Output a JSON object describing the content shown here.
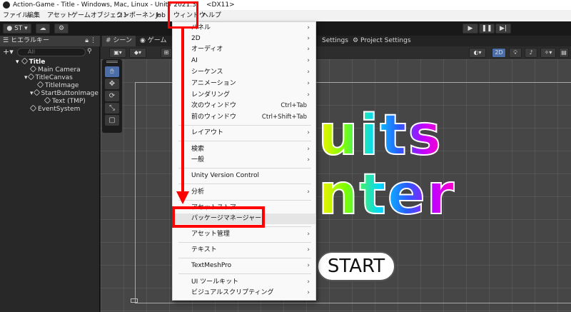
{
  "window": {
    "title_left": "Action-Game - Title - Windows, Mac, Linux - Unity 2021.3",
    "title_right": "<DX11>"
  },
  "menubar": [
    "ファイル",
    "編集",
    "アセット",
    "ゲームオブジェクト",
    "コンポーネント",
    "Job",
    "ウィンドウ",
    "ヘルプ"
  ],
  "toolbar": {
    "account": "ST",
    "play": "▶",
    "pause": "❚❚",
    "step": "▶|"
  },
  "hierarchy": {
    "tab_label": "ヒエラルキー",
    "search_placeholder": "All",
    "scene": "Title",
    "items": [
      "Main Camera",
      "TitleCanvas",
      "TitleImage",
      "StartButtonImage",
      "Text (TMP)",
      "EventSystem"
    ]
  },
  "scene_tabs": [
    "シーン",
    "ゲーム"
  ],
  "right_tabs": [
    "Settings",
    "Project Settings"
  ],
  "scene_toolbar": {
    "twod": "2D"
  },
  "scene_text": {
    "line1": "uits",
    "line2": "nter",
    "button": "START"
  },
  "dropdown": {
    "items": [
      {
        "label": "パネル",
        "arrow": true
      },
      {
        "label": "2D",
        "arrow": true
      },
      {
        "label": "オーディオ",
        "arrow": true
      },
      {
        "label": "AI",
        "arrow": true
      },
      {
        "label": "シーケンス",
        "arrow": true
      },
      {
        "label": "アニメーション",
        "arrow": true
      },
      {
        "label": "レンダリング",
        "arrow": true
      },
      {
        "label": "次のウィンドウ",
        "shortcut": "Ctrl+Tab"
      },
      {
        "label": "前のウィンドウ",
        "shortcut": "Ctrl+Shift+Tab"
      },
      {
        "label": "レイアウト",
        "arrow": true
      },
      {
        "label": "検索",
        "arrow": true
      },
      {
        "label": "一般",
        "arrow": true
      },
      {
        "label": "Unity Version Control"
      },
      {
        "label": "分析",
        "arrow": true
      },
      {
        "label": "アセットストア"
      },
      {
        "label": "パッケージマネージャー"
      },
      {
        "label": "アセット管理",
        "arrow": true
      },
      {
        "label": "テキスト",
        "arrow": true
      },
      {
        "label": "TextMeshPro",
        "arrow": true
      },
      {
        "label": "UI ツールキット",
        "arrow": true
      },
      {
        "label": "ビジュアルスクリプティング",
        "arrow": true
      }
    ]
  },
  "colors": {
    "highlight": "#ff0000",
    "menu_bg": "#f9f9f9",
    "editor_bg": "#282828"
  }
}
